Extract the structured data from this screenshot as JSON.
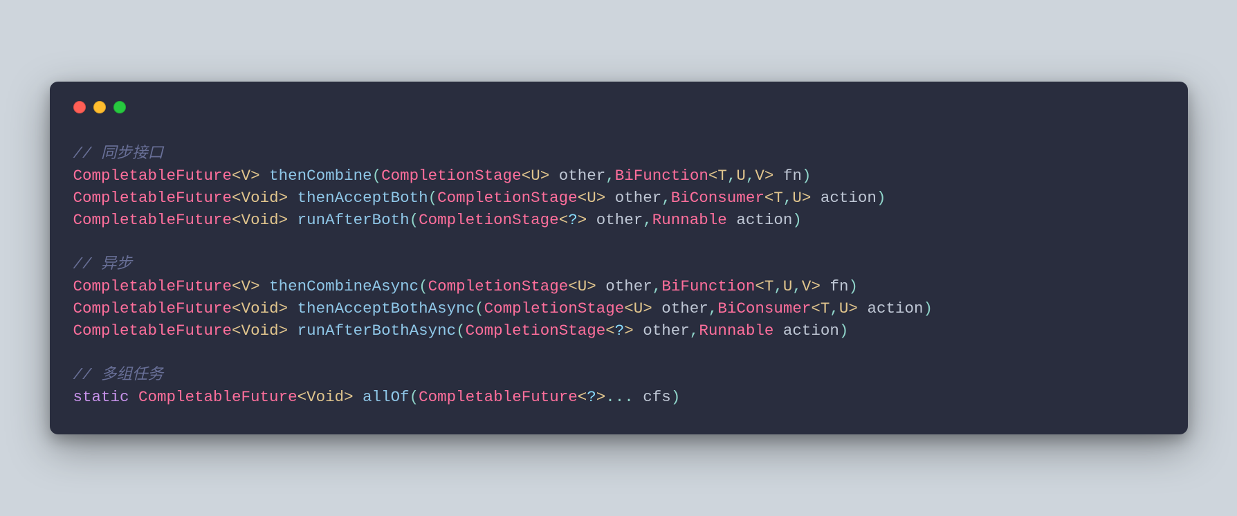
{
  "comments": {
    "sync": "// 同步接口",
    "async": "// 异步",
    "multi": "// 多组任务"
  },
  "tokens": {
    "CompletableFuture": "CompletableFuture",
    "CompletionStage": "CompletionStage",
    "BiFunction": "BiFunction",
    "BiConsumer": "BiConsumer",
    "Runnable": "Runnable",
    "Void": "Void",
    "V": "V",
    "U": "U",
    "T": "T",
    "static": "static",
    "other": "other",
    "fn": "fn",
    "action": "action",
    "cfs": "cfs",
    "q": "?",
    "lt": "<",
    "gt": ">",
    "lp": "(",
    "rp": ")",
    "comma": ",",
    "dots": "...",
    "sp": " "
  },
  "methods": {
    "thenCombine": "thenCombine",
    "thenAcceptBoth": "thenAcceptBoth",
    "runAfterBoth": "runAfterBoth",
    "thenCombineAsync": "thenCombineAsync",
    "thenAcceptBothAsync": "thenAcceptBothAsync",
    "runAfterBothAsync": "runAfterBothAsync",
    "allOf": "allOf"
  }
}
